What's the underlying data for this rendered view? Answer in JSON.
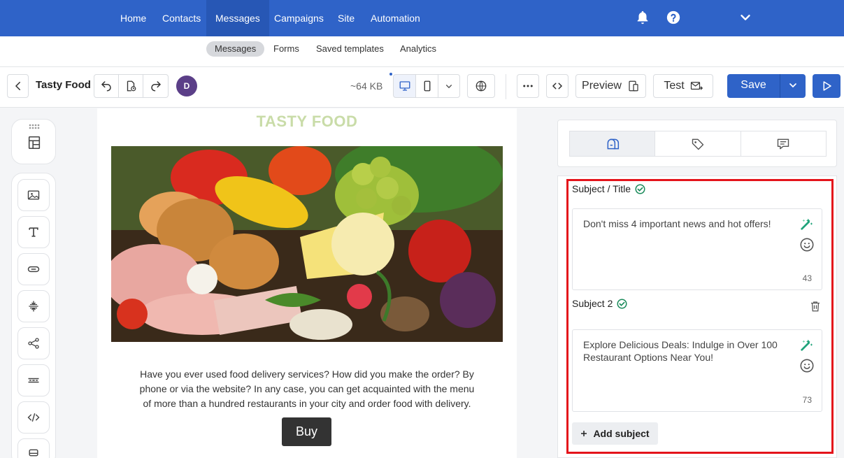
{
  "nav": {
    "items": [
      {
        "label": "Home"
      },
      {
        "label": "Contacts"
      },
      {
        "label": "Messages"
      },
      {
        "label": "Campaigns"
      },
      {
        "label": "Site"
      },
      {
        "label": "Automation"
      }
    ],
    "active": "Messages"
  },
  "subnav": {
    "items": [
      {
        "label": "Messages"
      },
      {
        "label": "Forms"
      },
      {
        "label": "Saved templates"
      },
      {
        "label": "Analytics"
      }
    ],
    "active": "Messages"
  },
  "toolbar": {
    "title": "Tasty Food",
    "avatar_initial": "D",
    "size": "~64 KB",
    "preview_label": "Preview",
    "test_label": "Test",
    "save_label": "Save"
  },
  "email": {
    "brand": "TASTY FOOD",
    "body": "Have you ever used food delivery services? How did you make the order? By phone or via the website? In any case, you can get acquainted with the menu of more than a hundred restaurants in your city and order food with delivery.",
    "button_label": "Buy"
  },
  "subjects": {
    "subject1_label": "Subject / Title",
    "subject1_text": "Don't miss 4 important news and hot offers!",
    "subject1_count": "43",
    "subject2_label": "Subject 2",
    "subject2_text": "Explore Delicious Deals: Indulge in Over 100 Restaurant Options Near You!",
    "subject2_count": "73",
    "add_label": "Add subject"
  },
  "colors": {
    "primary": "#2f63c8",
    "highlight": "#e4141b",
    "ok": "#1a8a5a"
  }
}
